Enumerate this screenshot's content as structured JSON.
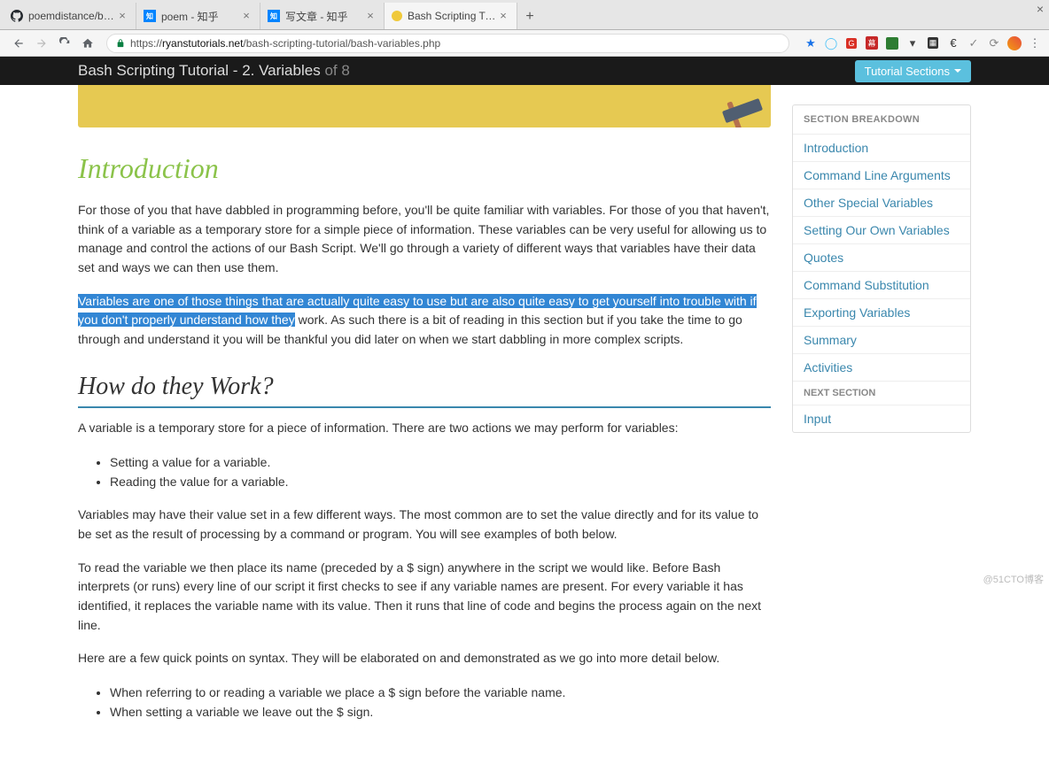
{
  "browser": {
    "tabs": [
      {
        "title": "poemdistance/baidu-tran",
        "favicon": "github"
      },
      {
        "title": "poem - 知乎",
        "favicon": "zhihu"
      },
      {
        "title": "写文章 - 知乎",
        "favicon": "zhihu"
      },
      {
        "title": "Bash Scripting Tutorial - V",
        "favicon": "dot-yellow",
        "active": true
      }
    ],
    "url_prefix": "https://",
    "url_domain": "ryanstutorials.net",
    "url_path": "/bash-scripting-tutorial/bash-variables.php"
  },
  "header": {
    "title_main": "Bash Scripting Tutorial - 2. Variables",
    "title_muted": "of 8",
    "button": "Tutorial Sections"
  },
  "content": {
    "intro_heading": "Introduction",
    "p1": "For those of you that have dabbled in programming before, you'll be quite familiar with variables. For those of you that haven't, think of a variable as a temporary store for a simple piece of information. These variables can be very useful for allowing us to manage and control the actions of our Bash Script. We'll go through a variety of different ways that variables have their data set and ways we can then use them.",
    "p2_highlight": "Variables are one of those things that are actually quite easy to use but are also quite easy to get yourself into trouble with if you don't properly understand how they",
    "p2_rest": " work. As such there is a bit of reading in this section but if you take the time to go through and understand it you will be thankful you did later on when we start dabbling in more complex scripts.",
    "how_heading": "How do they Work?",
    "p3": "A variable is a temporary store for a piece of information. There are two actions we may perform for variables:",
    "list1_a": "Setting a value for a variable.",
    "list1_b": "Reading the value for a variable.",
    "p4": "Variables may have their value set in a few different ways. The most common are to set the value directly and for its value to be set as the result of processing by a command or program. You will see examples of both below.",
    "p5": "To read the variable we then place its name (preceded by a $ sign) anywhere in the script we would like. Before Bash interprets (or runs) every line of our script it first checks to see if any variable names are present. For every variable it has identified, it replaces the variable name with its value. Then it runs that line of code and begins the process again on the next line.",
    "p6": "Here are a few quick points on syntax. They will be elaborated on and demonstrated as we go into more detail below.",
    "list2_a": "When referring to or reading a variable we place a $ sign before the variable name.",
    "list2_b": "When setting a variable we leave out the $ sign."
  },
  "sidebar": {
    "breakdown_label": "SECTION BREAKDOWN",
    "items": [
      "Introduction",
      "Command Line Arguments",
      "Other Special Variables",
      "Setting Our Own Variables",
      "Quotes",
      "Command Substitution",
      "Exporting Variables",
      "Summary",
      "Activities"
    ],
    "next_label": "NEXT SECTION",
    "next_item": "Input"
  },
  "watermark": "@51CTO博客"
}
